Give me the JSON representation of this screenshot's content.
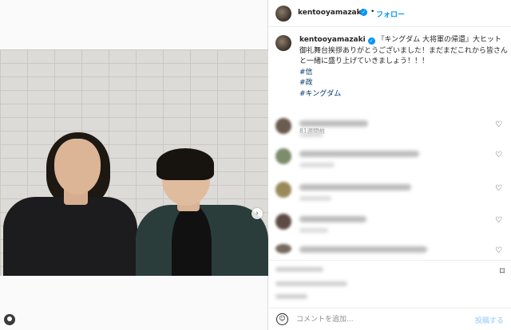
{
  "post": {
    "username": "kentooyamazaki",
    "separator": "•",
    "follow_label": "フォロー",
    "caption": {
      "username": "kentooyamazaki",
      "text": "『キングダム 大将軍の帰還』大ヒット御礼舞台挨拶ありがとうございました！まだまだこれから皆さんと一緒に盛り上げていきましょう！！！",
      "hashtags": [
        "#信",
        "#政",
        "#キングダム"
      ],
      "time": "81週間前"
    }
  },
  "comment_box": {
    "placeholder": "コメントを追加...",
    "post_label": "投稿する"
  },
  "icons": {
    "heart": "♡",
    "next_arrow": "›",
    "emoji": "☺",
    "bookmark": "⌑"
  }
}
